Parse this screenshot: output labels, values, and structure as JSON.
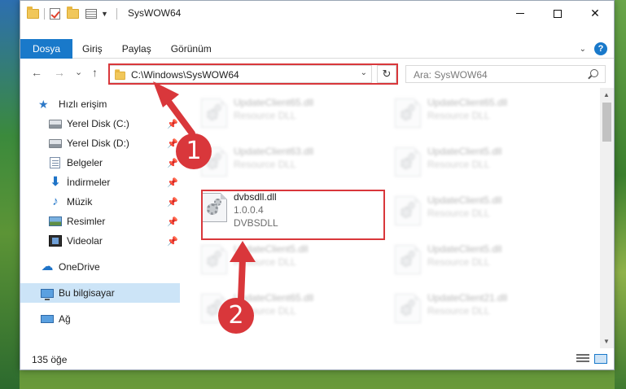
{
  "window": {
    "title": "SysWOW64",
    "controls": {
      "minimize": "",
      "maximize": "",
      "close": "✕"
    }
  },
  "ribbon": {
    "tabs": [
      "Dosya",
      "Giriş",
      "Paylaş",
      "Görünüm"
    ],
    "help": "?"
  },
  "navigation": {
    "back": "←",
    "forward": "→",
    "recent": "⌄",
    "up": "↑",
    "address": "C:\\Windows\\SysWOW64",
    "refresh": "↻",
    "search_placeholder": "Ara: SysWOW64"
  },
  "sidebar": {
    "quick_access": "Hızlı erişim",
    "items": [
      {
        "label": "Yerel Disk (C:)",
        "icon": "disk-icon",
        "pinned": true
      },
      {
        "label": "Yerel Disk (D:)",
        "icon": "disk-icon",
        "pinned": true
      },
      {
        "label": "Belgeler",
        "icon": "documents-icon",
        "pinned": true
      },
      {
        "label": "İndirmeler",
        "icon": "downloads-icon",
        "pinned": true
      },
      {
        "label": "Müzik",
        "icon": "music-icon",
        "pinned": true
      },
      {
        "label": "Resimler",
        "icon": "pictures-icon",
        "pinned": true
      },
      {
        "label": "Videolar",
        "icon": "videos-icon",
        "pinned": true
      }
    ],
    "onedrive": "OneDrive",
    "this_pc": "Bu bilgisayar",
    "network": "Ağ"
  },
  "files": [
    {
      "name": "UpdateClient65.dll",
      "type": "Resource DLL"
    },
    {
      "name": "UpdateClient65.dll",
      "type": "Resource DLL"
    },
    {
      "name": "UpdateClient63.dll",
      "type": "Resource DLL"
    },
    {
      "name": "UpdateClient5.dll",
      "type": "Resource DLL"
    },
    {
      "name": "dvbsdll.dll",
      "version": "1.0.0.4",
      "description": "DVBSDLL",
      "highlighted": true
    },
    {
      "name": "UpdateClient5.dll",
      "type": "Resource DLL"
    },
    {
      "name": "UpdateClient5.dll",
      "type": "Resource DLL"
    },
    {
      "name": "UpdateClient5.dll",
      "type": "Resource DLL"
    },
    {
      "name": "UpdateClient65.dll",
      "type": "Resource DLL"
    },
    {
      "name": "UpdateClient21.dll",
      "type": "Resource DLL"
    }
  ],
  "status": {
    "item_count": "135 öğe"
  },
  "annotations": {
    "step1": "1",
    "step2": "2",
    "highlight_color": "#d9373b"
  },
  "colors": {
    "file_tab": "#1979ca",
    "selected_nav": "#cce4f7"
  }
}
